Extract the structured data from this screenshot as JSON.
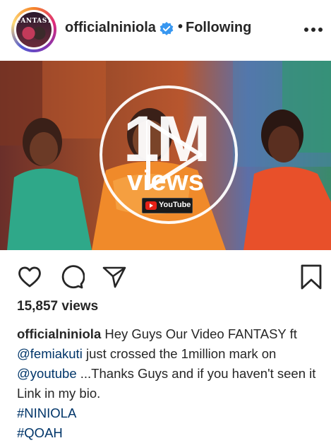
{
  "post": {
    "username": "officialniniola",
    "separator": "•",
    "follow_status": "Following",
    "avatar_text": "FANTASY"
  },
  "media": {
    "big_text": "1M",
    "views_word": "views",
    "badge_text": "YouTube"
  },
  "stats": {
    "views": "15,857 views"
  },
  "caption": {
    "username": "officialniniola",
    "part1": " Hey Guys Our Video FANTASY ft ",
    "mention1": "@femiakuti",
    "part2": " just crossed the 1million mark on ",
    "mention2": "@youtube",
    "part3": " ...Thanks Guys and if you haven't seen it Link in my bio.",
    "hashtags": [
      "#NINIOLA",
      "#QOAH"
    ]
  },
  "colors": {
    "verified_blue": "#3897f0",
    "link_blue": "#003569",
    "text": "#262626"
  },
  "icons": {
    "verified": "verified-badge-icon",
    "more": "more-options-icon",
    "like": "heart-icon",
    "comment": "comment-icon",
    "share": "share-icon",
    "save": "bookmark-icon",
    "play": "play-icon"
  }
}
